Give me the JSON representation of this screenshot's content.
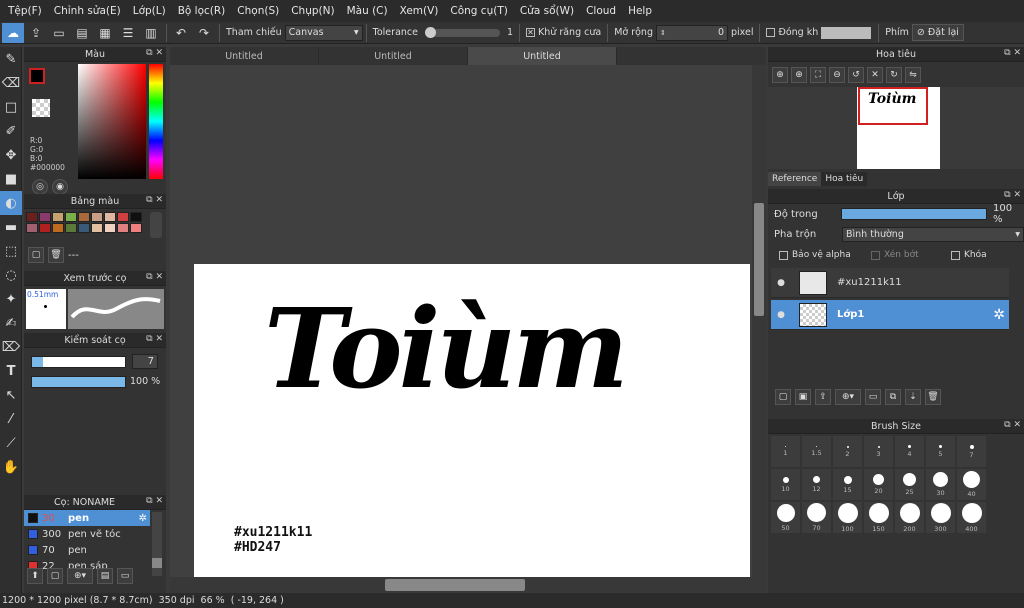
{
  "menu": [
    "Tệp(F)",
    "Chỉnh sửa(E)",
    "Lớp(L)",
    "Bộ lọc(R)",
    "Chọn(S)",
    "Chụp(N)",
    "Màu (C)",
    "Xem(V)",
    "Công cụ(T)",
    "Cửa sổ(W)",
    "Cloud",
    "Help"
  ],
  "toolbar": {
    "ref_label": "Tham chiếu",
    "ref_value": "Canvas",
    "tolerance_label": "Tolerance",
    "tolerance_value": "1",
    "antialias_label": "Khử răng cưa",
    "expand_label": "Mở rộng",
    "expand_value": "0",
    "expand_unit": "pixel",
    "close_label": "Đóng kh",
    "key_label": "Phím",
    "reset_label": "Đặt lại"
  },
  "color_panel": {
    "title": "Màu",
    "r": "R:0",
    "g": "G:0",
    "b": "B:0",
    "hex": "#000000",
    "fg_color": "#000000",
    "accent": "#cc2020"
  },
  "palette_panel": {
    "title": "Bảng màu",
    "name": "---",
    "colors": [
      "#6a2020",
      "#8a3a6a",
      "#c9a070",
      "#7ab04a",
      "#a86a3a",
      "#c8a088",
      "#e0b8a0",
      "#d04040",
      "#101010",
      "#a06070",
      "#b02020",
      "#c06a20",
      "#5a7a3a",
      "#3a5a7a",
      "#e0c0a0",
      "#f0d0c0",
      "#e08080",
      "#f08080"
    ]
  },
  "preview_panel": {
    "title": "Xem trước cọ",
    "size": "0.51mm"
  },
  "brush_control": {
    "title": "Kiểm soát cọ",
    "size_value": "7",
    "opacity_value": "100 %",
    "opacity_fraction": 1.0,
    "size_fraction": 0.07
  },
  "brush_list": {
    "title": "Cọ: NONAME",
    "items": [
      {
        "size": "30",
        "name": "pen",
        "color": "#101010",
        "selected": true
      },
      {
        "size": "300",
        "name": "pen vẽ tóc",
        "color": "#3060e0",
        "selected": false
      },
      {
        "size": "70",
        "name": "pen",
        "color": "#3060e0",
        "selected": false
      },
      {
        "size": "22",
        "name": "pen sáp",
        "color": "#e03030",
        "selected": false
      }
    ]
  },
  "tabs": [
    "Untitled",
    "Untitled",
    "Untitled"
  ],
  "canvas": {
    "art_text": "Toiùm",
    "hashtag1": "#xu1211k11",
    "hashtag2": "#HD247"
  },
  "navigator": {
    "title": "Hoa tiêu",
    "tab_reference": "Reference",
    "tab_navigator": "Hoa tiêu",
    "thumb_text": "Toiùm"
  },
  "layers": {
    "title": "Lớp",
    "opacity_label": "Độ trong",
    "opacity_value": "100 %",
    "opacity_fraction": 1.0,
    "blend_label": "Pha trộn",
    "blend_value": "Bình thường",
    "protect_alpha": "Bảo vệ alpha",
    "clip": "Xén bớt",
    "lock": "Khóa",
    "items": [
      {
        "name": "#xu1211k11",
        "selected": false
      },
      {
        "name": "Lớp1",
        "selected": true
      }
    ]
  },
  "brush_size": {
    "title": "Brush Size",
    "sizes": [
      "1",
      "1.5",
      "2",
      "3",
      "4",
      "5",
      "7",
      "10",
      "12",
      "15",
      "20",
      "25",
      "30",
      "40",
      "50",
      "70",
      "100",
      "150",
      "200",
      "300",
      "400"
    ]
  },
  "status": {
    "dimensions": "1200 * 1200 pixel",
    "physical": "(8.7 * 8.7cm)",
    "dpi": "350 dpi",
    "zoom": "66 %",
    "coords": "( -19, 264 )"
  }
}
